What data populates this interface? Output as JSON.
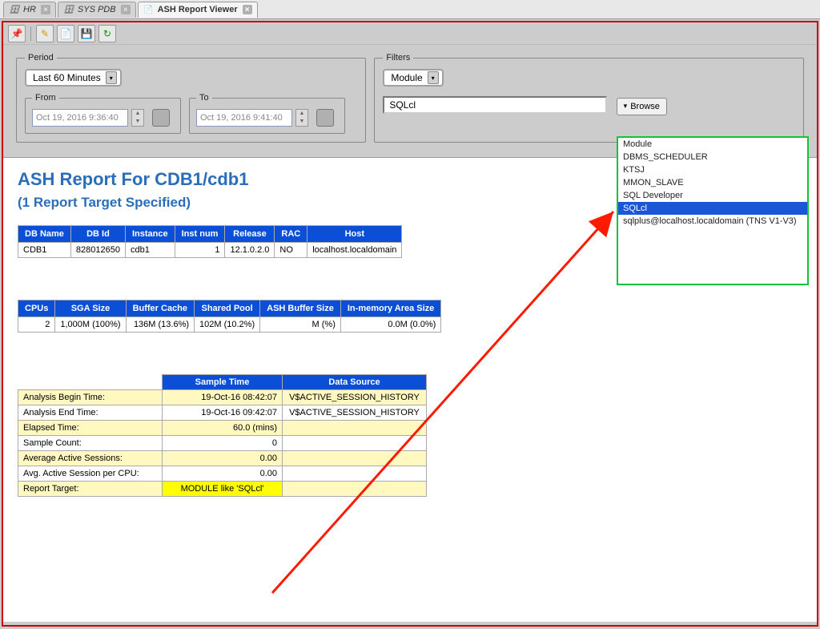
{
  "tabs": [
    {
      "label": "HR",
      "active": false
    },
    {
      "label": "SYS PDB",
      "active": false
    },
    {
      "label": "ASH Report Viewer",
      "active": true
    }
  ],
  "period": {
    "legend": "Period",
    "range_label": "Last 60 Minutes",
    "from_label": "From",
    "from_value": "Oct 19, 2016 9:36:40",
    "to_label": "To",
    "to_value": "Oct 19, 2016 9:41:40"
  },
  "filters": {
    "legend": "Filters",
    "dropdown_value": "Module",
    "input_value": "SQLcl",
    "browse_label": "Browse"
  },
  "popup": {
    "header": "Module",
    "items": [
      "DBMS_SCHEDULER",
      "KTSJ",
      "MMON_SLAVE",
      "SQL Developer",
      "SQLcl",
      "sqlplus@localhost.localdomain (TNS V1-V3)"
    ],
    "selected": "SQLcl"
  },
  "report": {
    "title": "ASH Report For CDB1/cdb1",
    "subtitle": "(1 Report Target Specified)",
    "db_headers": [
      "DB Name",
      "DB Id",
      "Instance",
      "Inst num",
      "Release",
      "RAC",
      "Host"
    ],
    "db_row": [
      "CDB1",
      "828012650",
      "cdb1",
      "1",
      "12.1.0.2.0",
      "NO",
      "localhost.localdomain"
    ],
    "sys_headers": [
      "CPUs",
      "SGA Size",
      "Buffer Cache",
      "Shared Pool",
      "ASH Buffer Size",
      "In-memory Area Size"
    ],
    "sys_row": [
      "2",
      "1,000M (100%)",
      "136M (13.6%)",
      "102M (10.2%)",
      "M (%)",
      "0.0M (0.0%)"
    ],
    "sample_headers": [
      "",
      "Sample Time",
      "Data Source"
    ],
    "sample_rows": [
      {
        "cls": "ylw",
        "cells": [
          "Analysis Begin Time:",
          "19-Oct-16 08:42:07",
          "V$ACTIVE_SESSION_HISTORY"
        ]
      },
      {
        "cls": "wht",
        "cells": [
          "Analysis End Time:",
          "19-Oct-16 09:42:07",
          "V$ACTIVE_SESSION_HISTORY"
        ]
      },
      {
        "cls": "ylw",
        "cells": [
          "Elapsed Time:",
          "60.0 (mins)",
          ""
        ]
      },
      {
        "cls": "wht",
        "cells": [
          "Sample Count:",
          "0",
          ""
        ]
      },
      {
        "cls": "ylw",
        "cells": [
          "Average Active Sessions:",
          "0.00",
          ""
        ]
      },
      {
        "cls": "wht",
        "cells": [
          "Avg. Active Session per CPU:",
          "0.00",
          ""
        ]
      },
      {
        "cls": "ylw",
        "cells": [
          "Report Target:",
          "MODULE like 'SQLcl'",
          ""
        ],
        "hl": true
      }
    ]
  }
}
